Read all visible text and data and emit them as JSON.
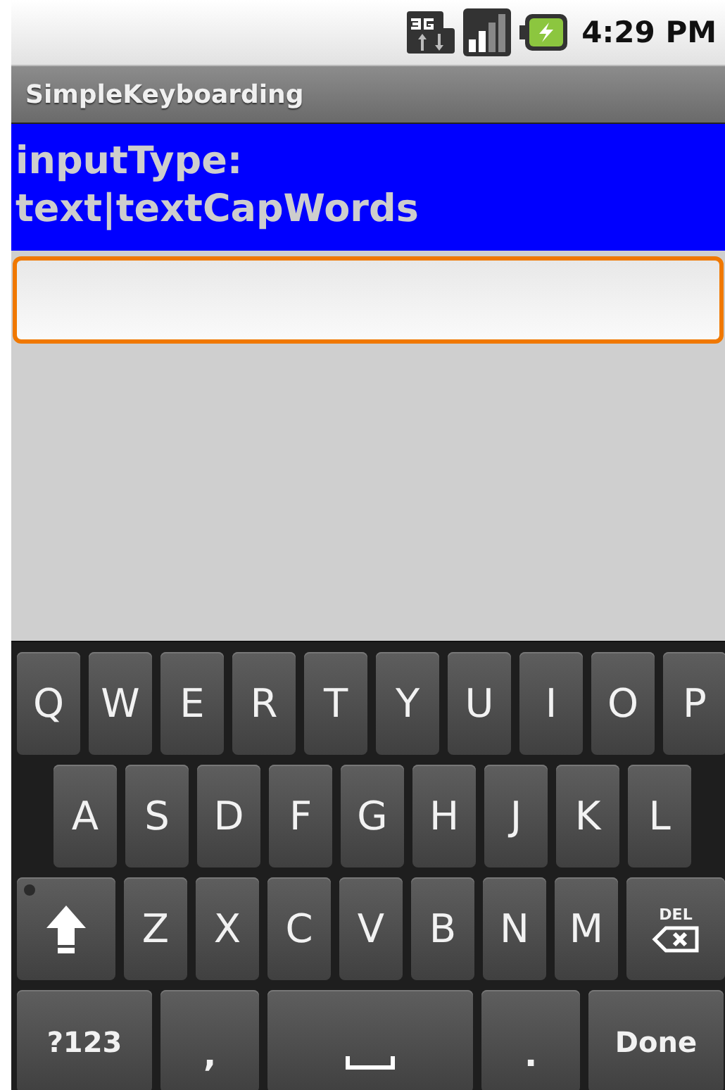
{
  "status_bar": {
    "time": "4:29 PM"
  },
  "app": {
    "title": "SimpleKeyboarding"
  },
  "label": "inputType:\ntext|textCapWords",
  "field": {
    "focused": true
  },
  "keyboard": {
    "shift_on": false,
    "rows": [
      {
        "keys": [
          {
            "kind": "letter",
            "label": "Q"
          },
          {
            "kind": "letter",
            "label": "W"
          },
          {
            "kind": "letter",
            "label": "E"
          },
          {
            "kind": "letter",
            "label": "R"
          },
          {
            "kind": "letter",
            "label": "T"
          },
          {
            "kind": "letter",
            "label": "Y"
          },
          {
            "kind": "letter",
            "label": "U"
          },
          {
            "kind": "letter",
            "label": "I"
          },
          {
            "kind": "letter",
            "label": "O"
          },
          {
            "kind": "letter",
            "label": "P"
          }
        ]
      },
      {
        "keys": [
          {
            "kind": "letter",
            "label": "A"
          },
          {
            "kind": "letter",
            "label": "S"
          },
          {
            "kind": "letter",
            "label": "D"
          },
          {
            "kind": "letter",
            "label": "F"
          },
          {
            "kind": "letter",
            "label": "G"
          },
          {
            "kind": "letter",
            "label": "H"
          },
          {
            "kind": "letter",
            "label": "J"
          },
          {
            "kind": "letter",
            "label": "K"
          },
          {
            "kind": "letter",
            "label": "L"
          }
        ]
      },
      {
        "keys": [
          {
            "kind": "shift"
          },
          {
            "kind": "letter",
            "label": "Z"
          },
          {
            "kind": "letter",
            "label": "X"
          },
          {
            "kind": "letter",
            "label": "C"
          },
          {
            "kind": "letter",
            "label": "V"
          },
          {
            "kind": "letter",
            "label": "B"
          },
          {
            "kind": "letter",
            "label": "N"
          },
          {
            "kind": "letter",
            "label": "M"
          },
          {
            "kind": "delete",
            "label": "DEL"
          }
        ]
      },
      {
        "keys": [
          {
            "kind": "function",
            "label": "?123"
          },
          {
            "kind": "symbol",
            "label": ","
          },
          {
            "kind": "space"
          },
          {
            "kind": "symbol",
            "label": "."
          },
          {
            "kind": "function",
            "label": "Done"
          }
        ]
      }
    ]
  }
}
